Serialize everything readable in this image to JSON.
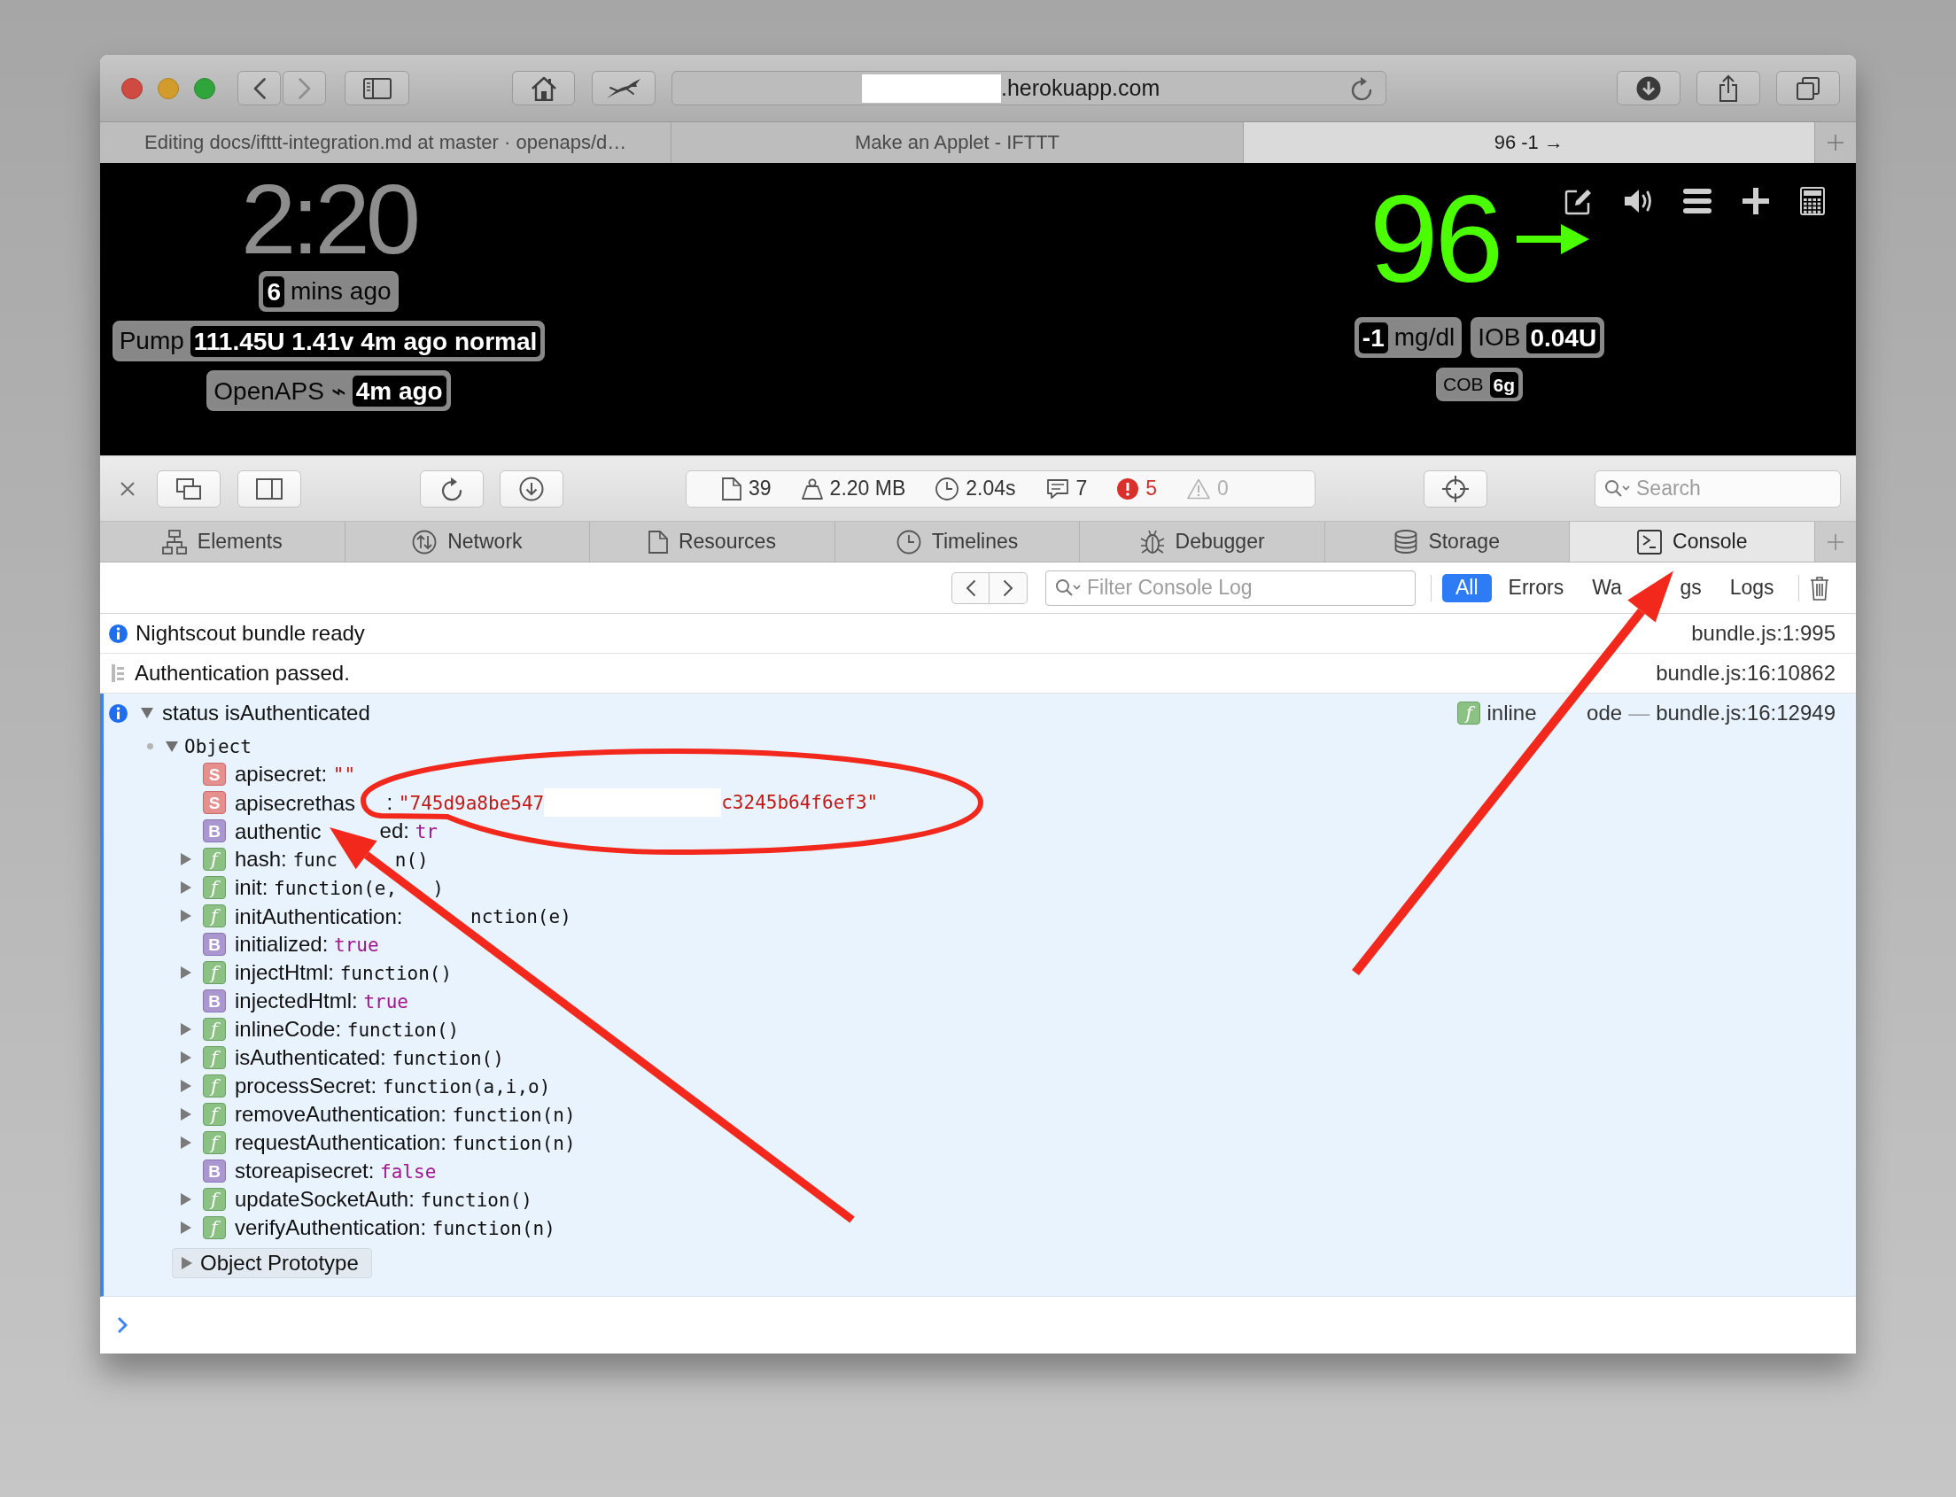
{
  "browser": {
    "nav": [
      {
        "kind": "back",
        "disabled": false
      },
      {
        "kind": "forward",
        "disabled": true
      }
    ],
    "address": {
      "redacted": true,
      "text": ".herokuapp.com"
    },
    "tabs": [
      {
        "label": "Editing docs/ifttt-integration.md at master · openaps/d…",
        "selected": false
      },
      {
        "label": "Make an Applet - IFTTT",
        "selected": false
      },
      {
        "label": "96 -1 →",
        "selected": true
      }
    ]
  },
  "nightscout": {
    "time": "2:20",
    "left_pills": [
      {
        "parts": [
          {
            "kind": "value",
            "text": "6"
          },
          {
            "kind": "label",
            "text": "mins ago"
          }
        ]
      },
      {
        "parts": [
          {
            "kind": "label",
            "text": "Pump"
          },
          {
            "kind": "value",
            "text": "111.45U 1.41v 4m ago normal"
          }
        ]
      },
      {
        "parts": [
          {
            "kind": "label",
            "text": "OpenAPS ⌁"
          },
          {
            "kind": "value",
            "text": "4m ago"
          }
        ]
      }
    ],
    "bg": "96",
    "right_pills": [
      [
        {
          "parts": [
            {
              "kind": "value",
              "text": "-1"
            },
            {
              "kind": "label",
              "text": "mg/dl"
            }
          ]
        },
        {
          "parts": [
            {
              "kind": "label",
              "text": "IOB"
            },
            {
              "kind": "value",
              "text": "0.04U"
            }
          ]
        }
      ],
      [
        {
          "parts": [
            {
              "kind": "label",
              "text": "COB"
            },
            {
              "kind": "value",
              "text": "6g"
            }
          ]
        }
      ]
    ]
  },
  "devtools": {
    "stats": [
      {
        "kind": "resources",
        "text": "39"
      },
      {
        "kind": "size",
        "text": "2.20 MB"
      },
      {
        "kind": "load_time",
        "text": "2.04s"
      },
      {
        "kind": "logs",
        "text": "7"
      },
      {
        "kind": "errors",
        "text": "5"
      },
      {
        "kind": "warnings",
        "text": "0"
      }
    ],
    "search": {
      "placeholder": "Search"
    },
    "tabs": [
      {
        "kind": "elements",
        "label": "Elements",
        "selected": false
      },
      {
        "kind": "network",
        "label": "Network",
        "selected": false
      },
      {
        "kind": "resources",
        "label": "Resources",
        "selected": false
      },
      {
        "kind": "timelines",
        "label": "Timelines",
        "selected": false
      },
      {
        "kind": "debugger",
        "label": "Debugger",
        "selected": false
      },
      {
        "kind": "storage",
        "label": "Storage",
        "selected": false
      },
      {
        "kind": "console",
        "label": "Console",
        "selected": true
      }
    ],
    "filter": {
      "placeholder": "Filter Console Log"
    },
    "levels": [
      {
        "label": "All",
        "selected": true
      },
      {
        "label": "Errors",
        "selected": false
      },
      {
        "label": "Wa",
        "label_after": "gs",
        "selected": false
      },
      {
        "label": "Logs",
        "selected": false
      }
    ],
    "messages": [
      {
        "kind": "info",
        "text": "Nightscout bundle ready",
        "source": "bundle.js:1:995"
      },
      {
        "kind": "log",
        "text": "Authentication passed.",
        "source": "bundle.js:16:10862"
      },
      {
        "kind": "info",
        "expanded": true,
        "text": "status isAuthenticated",
        "source_badge": "f",
        "source_function": "inline",
        "source_function_after": "ode",
        "source_separator": "—",
        "source": "bundle.js:16:12949",
        "object": {
          "label": "Object",
          "expanded": true,
          "properties": [
            {
              "kind": "string",
              "badge": "S",
              "runs": [
                {
                  "name": "apisecret:",
                  "value": "\"\""
                }
              ],
              "redacted": false
            },
            {
              "kind": "string",
              "badge": "S",
              "runs": [
                {
                  "name": "apisecrethas"
                },
                {
                  "name": ":",
                  "value": "\"745d9a8be547"
                }
              ],
              "redacted": true,
              "value_after": "c3245b64f6ef3\""
            },
            {
              "kind": "boolean",
              "badge": "B",
              "runs": [
                {
                  "name": "authentic"
                },
                {
                  "name": "ed:",
                  "value": "tr"
                }
              ],
              "redacted": false
            },
            {
              "kind": "function",
              "badge": "f",
              "runs": [
                {
                  "name": "hash:",
                  "value": "func"
                },
                {
                  "value": "n()"
                }
              ],
              "redacted": false
            },
            {
              "kind": "function",
              "badge": "f",
              "runs": [
                {
                  "name": "init:",
                  "value": "function(e,"
                },
                {
                  "value": ")"
                }
              ],
              "redacted": false
            },
            {
              "kind": "function",
              "badge": "f",
              "runs": [
                {
                  "name": "initAuthentication:"
                },
                {
                  "value": "nction(e)"
                }
              ],
              "redacted": false
            },
            {
              "kind": "boolean",
              "badge": "B",
              "runs": [
                {
                  "name": "initialized:",
                  "value": "true"
                }
              ],
              "redacted": false
            },
            {
              "kind": "function",
              "badge": "f",
              "runs": [
                {
                  "name": "injectHtml:",
                  "value": "function()"
                }
              ],
              "redacted": false
            },
            {
              "kind": "boolean",
              "badge": "B",
              "runs": [
                {
                  "name": "injectedHtml:",
                  "value": "true"
                }
              ],
              "redacted": false
            },
            {
              "kind": "function",
              "badge": "f",
              "runs": [
                {
                  "name": "inlineCode:",
                  "value": "function()"
                }
              ],
              "redacted": false
            },
            {
              "kind": "function",
              "badge": "f",
              "runs": [
                {
                  "name": "isAuthenticated:",
                  "value": "function()"
                }
              ],
              "redacted": false
            },
            {
              "kind": "function",
              "badge": "f",
              "runs": [
                {
                  "name": "processSecret:",
                  "value": "function(a,i,o)"
                }
              ],
              "redacted": false
            },
            {
              "kind": "function",
              "badge": "f",
              "runs": [
                {
                  "name": "removeAuthentication:",
                  "value": "function(n)"
                }
              ],
              "redacted": false
            },
            {
              "kind": "function",
              "badge": "f",
              "runs": [
                {
                  "name": "requestAuthentication:",
                  "value": "function(n)"
                }
              ],
              "redacted": false
            },
            {
              "kind": "boolean",
              "badge": "B",
              "runs": [
                {
                  "name": "storeapisecret:",
                  "value": "false"
                }
              ],
              "redacted": false
            },
            {
              "kind": "function",
              "badge": "f",
              "runs": [
                {
                  "name": "updateSocketAuth:",
                  "value": "function()"
                }
              ],
              "redacted": false
            },
            {
              "kind": "function",
              "badge": "f",
              "runs": [
                {
                  "name": "verifyAuthentication:",
                  "value": "function(n)"
                }
              ],
              "redacted": false
            }
          ],
          "prototype": "Object Prototype"
        }
      }
    ]
  }
}
